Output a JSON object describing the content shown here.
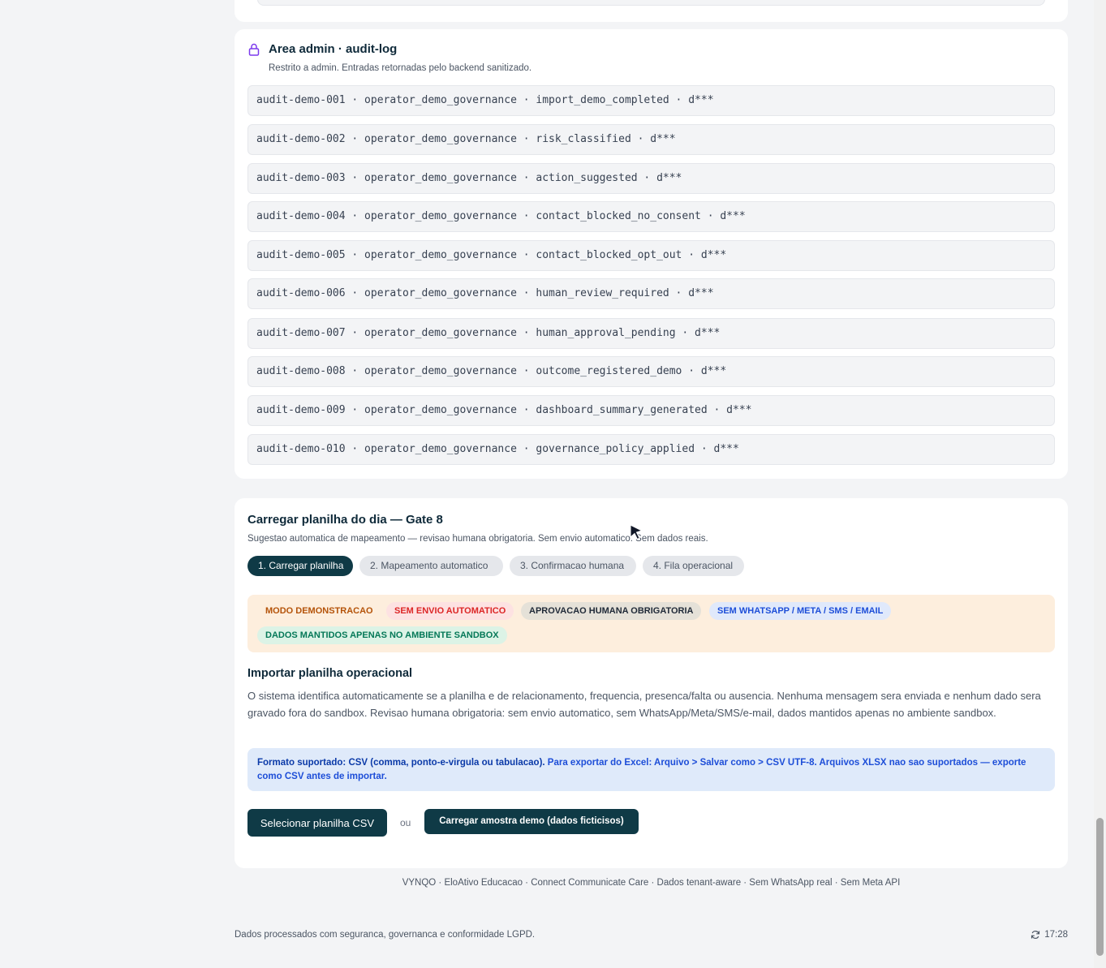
{
  "audit": {
    "title": "Area admin · audit-log",
    "subtitle": "Restrito a admin. Entradas retornadas pelo backend sanitizado.",
    "entries": [
      "audit-demo-001 · operator_demo_governance · import_demo_completed · d***",
      "audit-demo-002 · operator_demo_governance · risk_classified · d***",
      "audit-demo-003 · operator_demo_governance · action_suggested · d***",
      "audit-demo-004 · operator_demo_governance · contact_blocked_no_consent · d***",
      "audit-demo-005 · operator_demo_governance · contact_blocked_opt_out · d***",
      "audit-demo-006 · operator_demo_governance · human_review_required · d***",
      "audit-demo-007 · operator_demo_governance · human_approval_pending · d***",
      "audit-demo-008 · operator_demo_governance · outcome_registered_demo · d***",
      "audit-demo-009 · operator_demo_governance · dashboard_summary_generated · d***",
      "audit-demo-010 · operator_demo_governance · governance_policy_applied · d***"
    ]
  },
  "upload": {
    "title": "Carregar planilha do dia — Gate 8",
    "subtitle": "Sugestao automatica de mapeamento — revisao humana obrigatoria. Sem envio automatico. Sem dados reais.",
    "steps": [
      "1. Carregar planilha",
      "2. Mapeamento automatico",
      "3. Confirmacao humana",
      "4. Fila operacional"
    ],
    "badges": [
      "MODO DEMONSTRACAO",
      "SEM ENVIO AUTOMATICO",
      "APROVACAO HUMANA OBRIGATORIA",
      "SEM WHATSAPP / META / SMS / EMAIL",
      "DADOS MANTIDOS APENAS NO AMBIENTE SANDBOX"
    ],
    "import_title": "Importar planilha operacional",
    "import_desc": "O sistema identifica automaticamente se a planilha e de relacionamento, frequencia, presenca/falta ou ausencia. Nenhuma mensagem sera enviada e nenhum dado sera gravado fora do sandbox. Revisao humana obrigatoria: sem envio automatico, sem WhatsApp/Meta/SMS/e-mail, dados mantidos apenas no ambiente sandbox.",
    "format_strong": "Formato suportado: CSV (comma, ponto-e-virgula ou tabulacao).",
    "format_rest": " Para exportar do Excel: Arquivo > Salvar como > CSV UTF-8. Arquivos XLSX nao sao suportados — exporte como CSV antes de importar.",
    "select_button": "Selecionar planilha CSV",
    "or_label": "ou",
    "demo_button": "Carregar amostra demo (dados ficticisos)"
  },
  "footer": {
    "links": "VYNQO · EloAtivo Educacao · Connect Communicate Care · Dados tenant-aware · Sem WhatsApp real · Sem Meta API",
    "note": "Dados processados com seguranca, governanca e conformidade LGPD.",
    "time": "17:28"
  },
  "colors": {
    "primary": "#0f3a46",
    "badge_orange": "#b45309",
    "badge_red": "#dc2626",
    "badge_dark": "#1f2937",
    "badge_blue": "#1d4ed8",
    "badge_green": "#047857"
  }
}
